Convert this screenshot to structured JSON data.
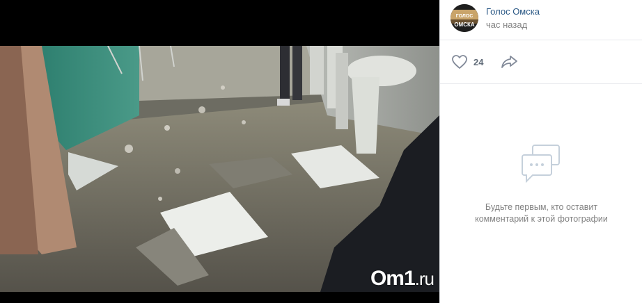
{
  "post": {
    "author": "Голос Омска",
    "time": "час назад",
    "avatar_text_line1": "ГОЛОС",
    "avatar_text_line2": "ОМСКА"
  },
  "actions": {
    "likes": "24",
    "like_icon": "heart-icon",
    "share_icon": "share-icon"
  },
  "comments": {
    "empty_icon": "comment-bubble-icon",
    "empty_text": "Будьте первым, кто оставит\nкомментарий к этой фотографии"
  },
  "photo": {
    "watermark_main": "Om1",
    "watermark_suffix": ".ru"
  },
  "colors": {
    "link": "#2a5885",
    "muted": "#828282",
    "border": "#e7e8ec"
  }
}
